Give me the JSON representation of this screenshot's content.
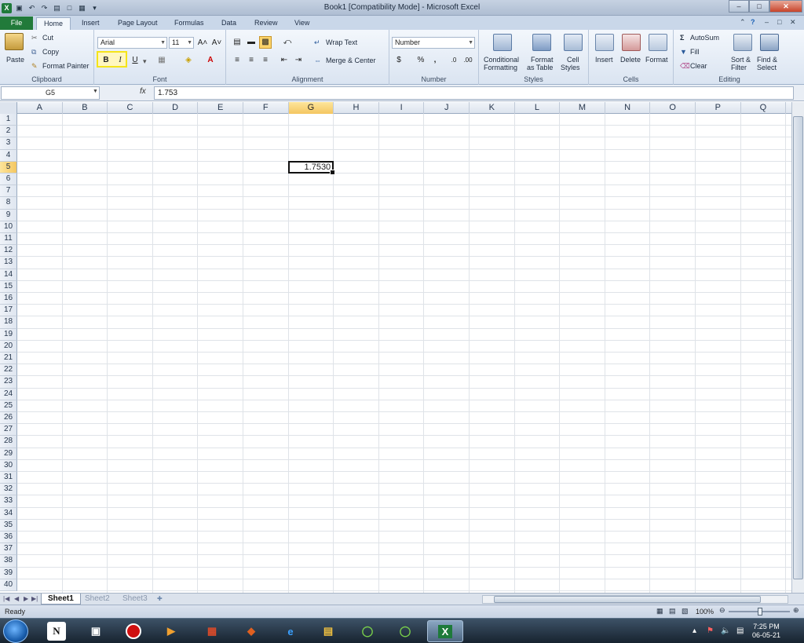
{
  "window": {
    "title": "Book1  [Compatibility Mode]  -  Microsoft Excel",
    "min_glyph": "–",
    "max_glyph": "□",
    "close_glyph": "✕"
  },
  "tabs": [
    "File",
    "Home",
    "Insert",
    "Page Layout",
    "Formulas",
    "Data",
    "Review",
    "View"
  ],
  "active_tab": "Home",
  "ribbon": {
    "clipboard": {
      "paste": "Paste",
      "cut": "Cut",
      "copy": "Copy",
      "format_painter": "Format Painter",
      "label": "Clipboard"
    },
    "font": {
      "name": "Arial",
      "size": "11",
      "bold": "B",
      "italic": "I",
      "underline": "U",
      "grow": "A˄",
      "shrink": "A˅",
      "label": "Font"
    },
    "alignment": {
      "wrap": "Wrap Text",
      "merge": "Merge & Center",
      "label": "Alignment"
    },
    "number": {
      "format": "Number",
      "currency": "$",
      "percent": "%",
      "comma": ",",
      "label": "Number"
    },
    "styles": {
      "cond1": "Conditional",
      "cond2": "Formatting",
      "fmt1": "Format",
      "fmt2": "as Table",
      "cell1": "Cell",
      "cell2": "Styles",
      "label": "Styles"
    },
    "cells": {
      "insert": "Insert",
      "delete": "Delete",
      "format": "Format",
      "label": "Cells"
    },
    "editing": {
      "autosum": "AutoSum",
      "fill": "Fill",
      "clear": "Clear",
      "sort1": "Sort &",
      "sort2": "Filter",
      "find1": "Find &",
      "find2": "Select",
      "label": "Editing"
    }
  },
  "formula_bar": {
    "name_box": "G5",
    "fx": "fx",
    "value": "1.753"
  },
  "columns": [
    "A",
    "B",
    "C",
    "D",
    "E",
    "F",
    "G",
    "H",
    "I",
    "J",
    "K",
    "L",
    "M",
    "N",
    "O",
    "P",
    "Q"
  ],
  "selected_column": "G",
  "selected_row": 5,
  "row_count": 40,
  "active_cell": {
    "ref": "G5",
    "display": "1.7530"
  },
  "sheets": [
    "Sheet1",
    "Sheet2",
    "Sheet3"
  ],
  "active_sheet": "Sheet1",
  "status": {
    "text": "Ready",
    "zoom": "100%"
  },
  "taskbar": {
    "time": "7:25 PM",
    "date": "06-05-21",
    "notion": "N"
  },
  "colors": {
    "accent": "#217a3a",
    "highlight": "#f5e41a",
    "selection": "#f4c660"
  }
}
